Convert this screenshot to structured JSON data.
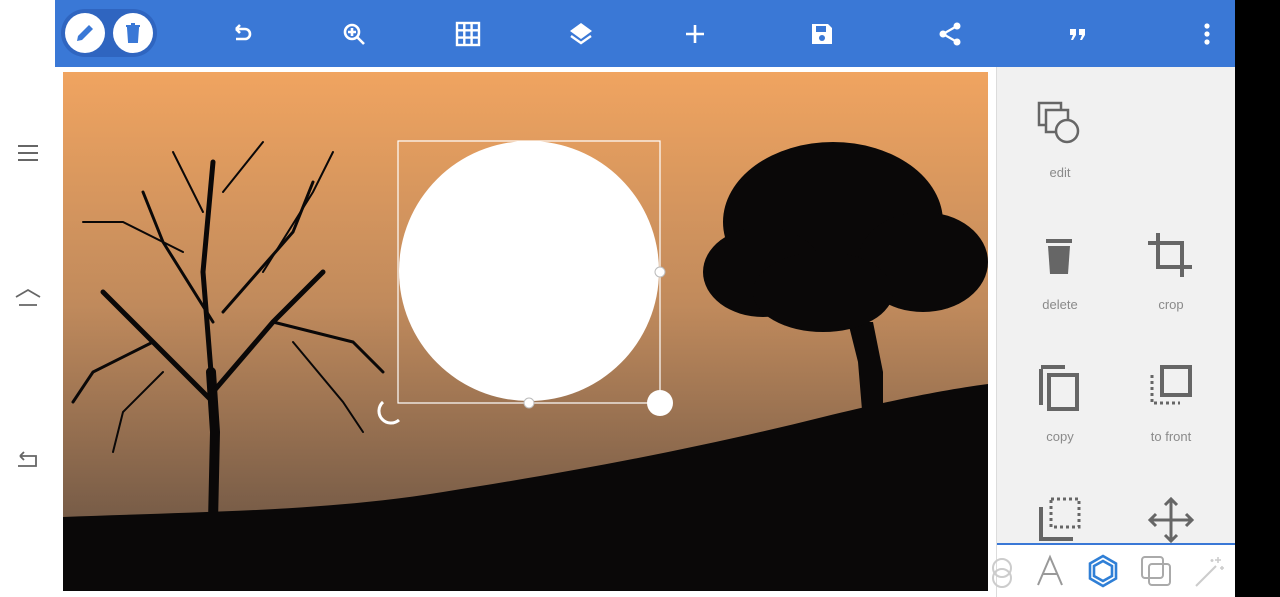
{
  "toolbar": {
    "mode_buttons": [
      {
        "id": "draw",
        "icon": "pencil-icon",
        "active": true
      },
      {
        "id": "trash",
        "icon": "trash-icon",
        "active": false
      }
    ],
    "actions": [
      {
        "id": "undo",
        "icon": "undo-icon"
      },
      {
        "id": "zoom",
        "icon": "zoom-in-icon"
      },
      {
        "id": "grid",
        "icon": "grid-icon"
      },
      {
        "id": "layers",
        "icon": "layers-icon"
      },
      {
        "id": "add",
        "icon": "plus-icon"
      },
      {
        "id": "save",
        "icon": "save-icon"
      },
      {
        "id": "share",
        "icon": "share-icon"
      },
      {
        "id": "quote",
        "icon": "quote-icon"
      },
      {
        "id": "more",
        "icon": "more-vertical-icon"
      }
    ]
  },
  "nav": {
    "buttons": [
      {
        "id": "menu",
        "icon": "menu-icon"
      },
      {
        "id": "home",
        "icon": "home-icon"
      },
      {
        "id": "back",
        "icon": "back-icon"
      }
    ]
  },
  "panel": {
    "items": [
      {
        "id": "edit",
        "label": "edit",
        "icon": "edit-shapes-icon"
      },
      {
        "id": "delete",
        "label": "delete",
        "icon": "trash-icon"
      },
      {
        "id": "crop",
        "label": "crop",
        "icon": "crop-icon"
      },
      {
        "id": "copy",
        "label": "copy",
        "icon": "copy-icon"
      },
      {
        "id": "to_front",
        "label": "to front",
        "icon": "bring-to-front-icon"
      },
      {
        "id": "to_back",
        "label": "",
        "icon": "send-to-back-icon"
      },
      {
        "id": "move",
        "label": "",
        "icon": "move-icon"
      }
    ],
    "tabs": [
      {
        "id": "blend",
        "icon": "blend-icon",
        "active": false
      },
      {
        "id": "text",
        "icon": "text-icon",
        "active": false
      },
      {
        "id": "shape",
        "icon": "hexagon-icon",
        "active": true
      },
      {
        "id": "layer",
        "icon": "overlap-icon",
        "active": false
      },
      {
        "id": "magic",
        "icon": "magic-wand-icon",
        "active": false
      }
    ]
  },
  "colors": {
    "toolbar": "#3a78d6",
    "sky_top": "#f0a460",
    "sky_bottom": "#6f5a4a",
    "silhouette": "#0a0808",
    "panel_bg": "#f1f1f1",
    "accent": "#2f7fd6"
  }
}
